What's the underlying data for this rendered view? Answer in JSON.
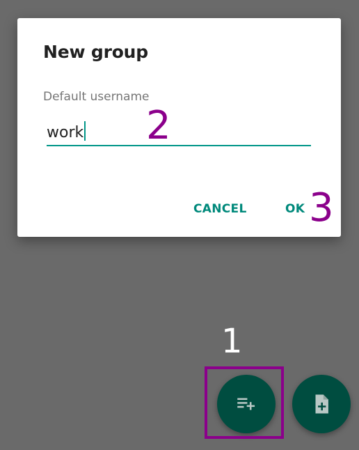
{
  "dialog": {
    "title": "New group",
    "field_label": "Default username",
    "field_value": "work",
    "cancel_label": "CANCEL",
    "ok_label": "OK"
  },
  "annotations": {
    "marker_1": "1",
    "marker_2": "2",
    "marker_3": "3"
  },
  "fabs": {
    "add_group_icon": "playlist-add-icon",
    "add_file_icon": "note-add-icon"
  },
  "colors": {
    "accent": "#009688",
    "fab_background": "#004d40",
    "annotation": "#8b008b",
    "scrim": "#6a6a6a"
  }
}
